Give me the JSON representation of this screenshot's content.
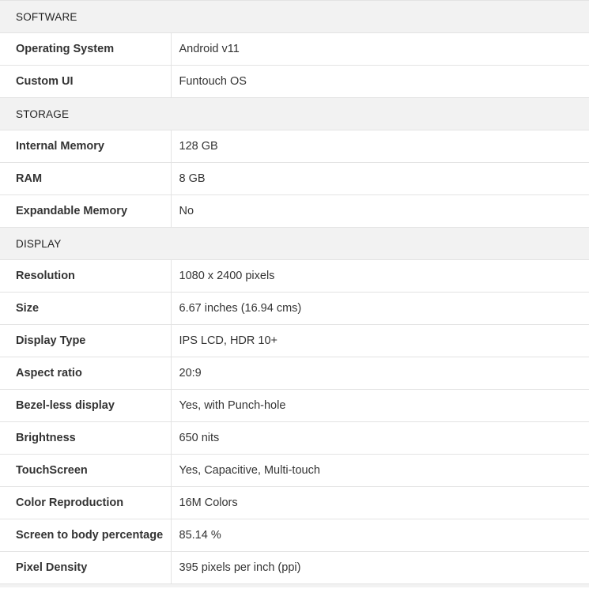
{
  "sections": [
    {
      "title": "SOFTWARE",
      "rows": [
        {
          "label": "Operating System",
          "value": "Android v11"
        },
        {
          "label": "Custom UI",
          "value": "Funtouch OS"
        }
      ]
    },
    {
      "title": "STORAGE",
      "rows": [
        {
          "label": "Internal Memory",
          "value": "128 GB"
        },
        {
          "label": "RAM",
          "value": "8 GB"
        },
        {
          "label": "Expandable Memory",
          "value": "No"
        }
      ]
    },
    {
      "title": "DISPLAY",
      "rows": [
        {
          "label": "Resolution",
          "value": "1080 x 2400 pixels"
        },
        {
          "label": "Size",
          "value": "6.67 inches (16.94 cms)"
        },
        {
          "label": "Display Type",
          "value": "IPS LCD, HDR 10+"
        },
        {
          "label": "Aspect ratio",
          "value": "20:9"
        },
        {
          "label": "Bezel-less display",
          "value": "Yes, with Punch-hole"
        },
        {
          "label": "Brightness",
          "value": "650 nits"
        },
        {
          "label": "TouchScreen",
          "value": "Yes, Capacitive, Multi-touch"
        },
        {
          "label": "Color Reproduction",
          "value": "16M Colors"
        },
        {
          "label": "Screen to body percentage",
          "value": "85.14 %"
        },
        {
          "label": "Pixel Density",
          "value": "395 pixels per inch (ppi)"
        }
      ]
    }
  ]
}
